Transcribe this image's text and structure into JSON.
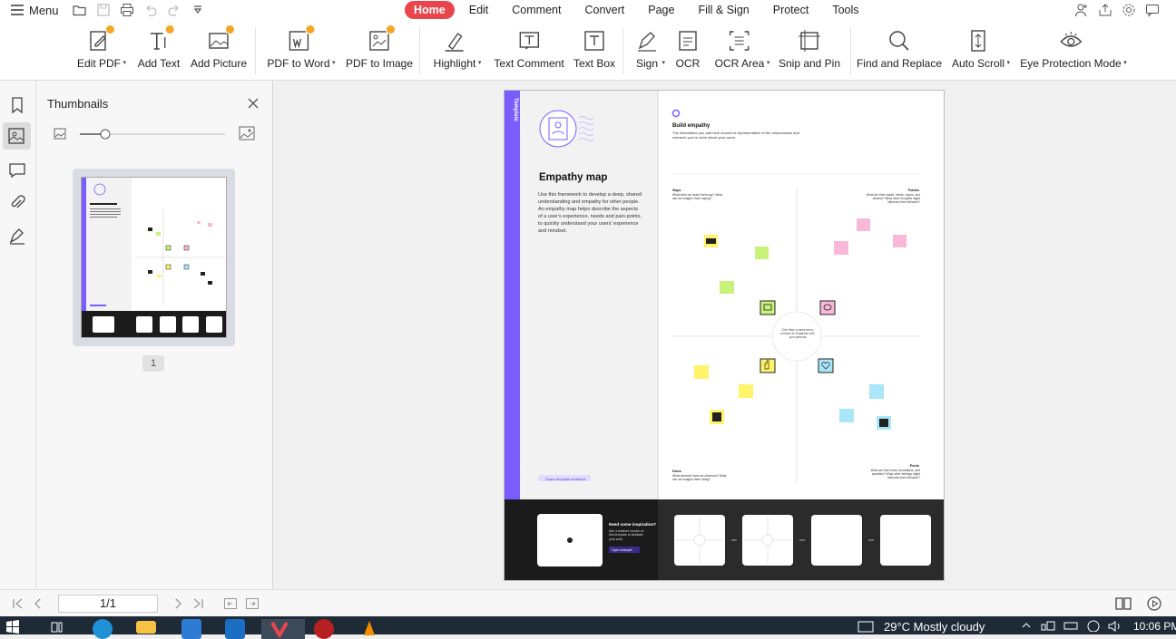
{
  "topbar": {
    "menu_label": "Menu",
    "tabs": [
      "Home",
      "Edit",
      "Comment",
      "Convert",
      "Page",
      "Fill & Sign",
      "Protect",
      "Tools"
    ],
    "active_tab": "Home"
  },
  "ribbon": {
    "items": [
      {
        "label": "Edit PDF",
        "icon": "edit-pdf-icon",
        "dropdown": true
      },
      {
        "label": "Add Text",
        "icon": "add-text-icon"
      },
      {
        "label": "Add Picture",
        "icon": "add-picture-icon"
      },
      {
        "label": "PDF to Word",
        "icon": "pdf-to-word-icon",
        "dropdown": true
      },
      {
        "label": "PDF to Image",
        "icon": "pdf-to-image-icon"
      },
      {
        "label": "Highlight",
        "icon": "highlight-icon",
        "dropdown": true
      },
      {
        "label": "Text Comment",
        "icon": "text-comment-icon"
      },
      {
        "label": "Text Box",
        "icon": "text-box-icon"
      },
      {
        "label": "Sign",
        "icon": "sign-icon",
        "dropdown": true
      },
      {
        "label": "OCR",
        "icon": "ocr-icon"
      },
      {
        "label": "OCR Area",
        "icon": "ocr-area-icon",
        "dropdown": true
      },
      {
        "label": "Snip and Pin",
        "icon": "snip-pin-icon"
      },
      {
        "label": "Find and Replace",
        "icon": "find-replace-icon"
      },
      {
        "label": "Auto Scroll",
        "icon": "auto-scroll-icon",
        "dropdown": true
      },
      {
        "label": "Eye Protection Mode",
        "icon": "eye-icon",
        "dropdown": true
      }
    ]
  },
  "thumbnails": {
    "title": "Thumbnails",
    "page_number": "1"
  },
  "document": {
    "side_tab": "Template",
    "title": "Empathy map",
    "description": "Use this framework to develop a deep, shared understanding and empathy for other people. An empathy map helps describe the aspects of a user's experience, needs and pain points, to quickly understand your users' experience and mindset.",
    "feedback": "Share template feedback",
    "build_heading": "Build empathy",
    "build_text": "The information you add here should be representative of the observations and research you've done about your users.",
    "says_title": "Says",
    "says_text": "What have we heard them say? What can we imagine them saying?",
    "thinks_title": "Thinks",
    "thinks_text": "What are their wants, needs, hopes, and dreams? What other thoughts might influence their behavior?",
    "does_title": "Does",
    "does_text": "What behavior have we observed? What can we imagine them doing?",
    "feels_title": "Feels",
    "feels_text": "What are their fears, frustrations, and anxieties? What other feelings might influence their behavior?",
    "center_text": "Give them a name and a persona to empathize with your persona",
    "inspiration_title": "Need some inspiration?",
    "inspiration_text": "See a finished version of this template to kickstart your work.",
    "open_example": "Open example"
  },
  "statusbar": {
    "page_indicator": "1/1"
  },
  "taskbar": {
    "weather": "29°C  Mostly cloudy",
    "time": "10:06 PM"
  },
  "colors": {
    "accent": "#e8464c",
    "purple": "#7b5cff",
    "sticky_yellow": "#fff36a",
    "sticky_green": "#c9f27a",
    "sticky_pink": "#f9b8d8",
    "sticky_blue": "#a9e6f7"
  }
}
